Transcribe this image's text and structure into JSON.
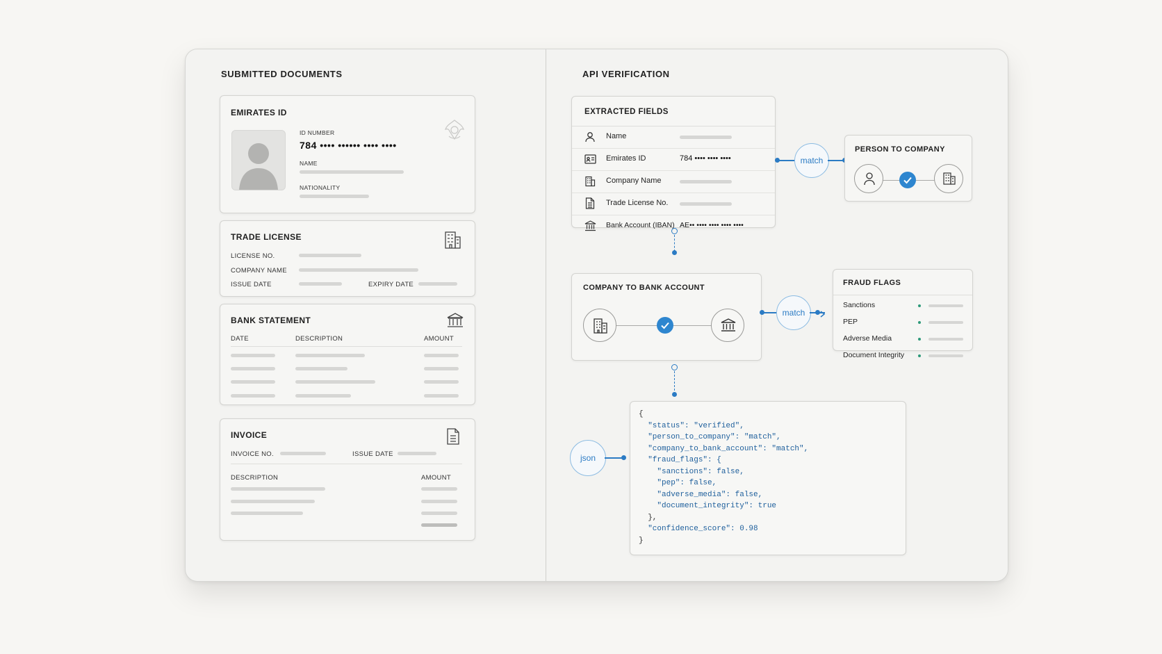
{
  "left": {
    "title": "SUBMITTED DOCUMENTS",
    "emirates_id": {
      "title": "EMIRATES ID",
      "id_number_label": "ID NUMBER",
      "id_number_value": "784 •••• •••••• •••• ••••",
      "name_label": "NAME",
      "nationality_label": "NATIONALITY"
    },
    "trade_license": {
      "title": "TRADE LICENSE",
      "license_no_label": "LICENSE NO.",
      "company_name_label": "COMPANY NAME",
      "issue_date_label": "ISSUE DATE",
      "expiry_date_label": "EXPIRY DATE"
    },
    "bank_statement": {
      "title": "BANK STATEMENT",
      "columns": [
        "DATE",
        "DESCRIPTION",
        "AMOUNT"
      ]
    },
    "invoice": {
      "title": "INVOICE",
      "invoice_no_label": "INVOICE NO.",
      "issue_date_label": "ISSUE DATE",
      "description_label": "DESCRIPTION",
      "amount_label": "AMOUNT"
    }
  },
  "right": {
    "title": "API VERIFICATION",
    "extracted_fields": {
      "title": "EXTRACTED FIELDS",
      "rows": [
        {
          "label": "Name",
          "value": "",
          "icon": "person-icon"
        },
        {
          "label": "Emirates ID",
          "value": "784 •••• •••• ••••",
          "icon": "id-card-icon"
        },
        {
          "label": "Company Name",
          "value": "",
          "icon": "building-icon"
        },
        {
          "label": "Trade License No.",
          "value": "",
          "icon": "document-icon"
        },
        {
          "label": "Bank Account (IBAN)",
          "value": "AE•• •••• •••• •••• ••••",
          "icon": "bank-icon"
        }
      ]
    },
    "match_label_1": "match",
    "match_label_2": "match",
    "person_to_company": {
      "title": "PERSON TO COMPANY"
    },
    "company_to_bank": {
      "title": "COMPANY TO BANK ACCOUNT"
    },
    "fraud_flags": {
      "title": "FRAUD FLAGS",
      "items": [
        "Sanctions",
        "PEP",
        "Adverse Media",
        "Document Integrity"
      ]
    },
    "json_label": "json",
    "json_lines": [
      "{",
      "  \"status\": \"verified\",",
      "  \"person_to_company\": \"match\",",
      "  \"company_to_bank_account\": \"match\",",
      "  \"fraud_flags\": {",
      "    \"sanctions\": false,",
      "    \"pep\": false,",
      "    \"adverse_media\": false,",
      "    \"document_integrity\": true",
      "  },",
      "  \"confidence_score\": 0.98",
      "}"
    ]
  },
  "colors": {
    "accent": "#2b7bc4",
    "status_dot": "#2e9a7a"
  }
}
